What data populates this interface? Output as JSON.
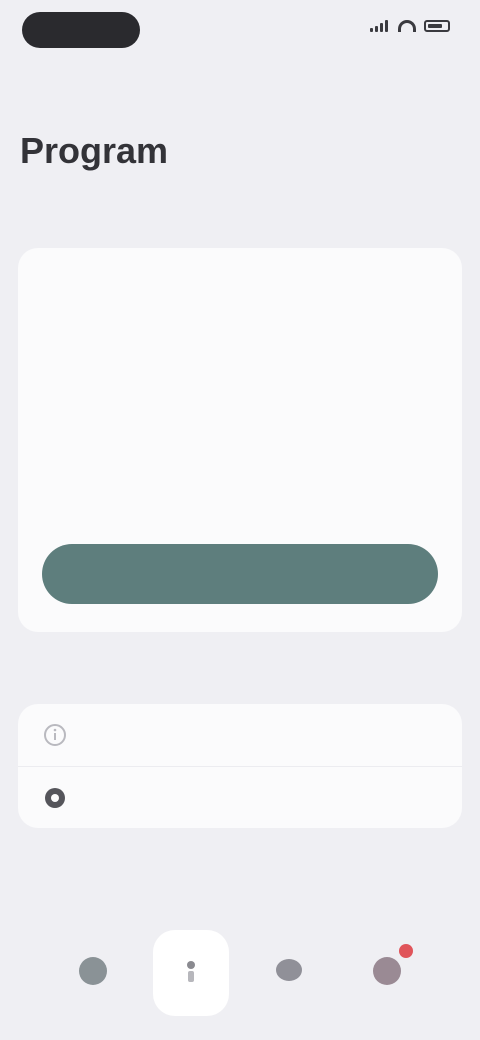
{
  "status_bar": {
    "time": "",
    "accent": "#2a2a2e"
  },
  "page": {
    "title": "Program"
  },
  "sections": {
    "main_label": "",
    "settings_label": ""
  },
  "main_card": {
    "title": "",
    "subtitle": "",
    "paragraph_1": "",
    "paragraph_2": "",
    "button_label": "",
    "button_color": "#5e7e7d"
  },
  "settings": {
    "items": [
      {
        "label": "",
        "icon": "info-icon"
      },
      {
        "label": "",
        "icon": "help-icon"
      }
    ]
  },
  "tab_bar": {
    "tabs": [
      {
        "label": "",
        "icon": "home-icon",
        "active": false
      },
      {
        "label": "",
        "icon": "person-icon",
        "active": true
      },
      {
        "label": "",
        "icon": "chat-icon",
        "active": false
      },
      {
        "label": "",
        "icon": "profile-icon",
        "active": false
      }
    ],
    "badge_count": "",
    "badge_color": "#e0545a"
  }
}
